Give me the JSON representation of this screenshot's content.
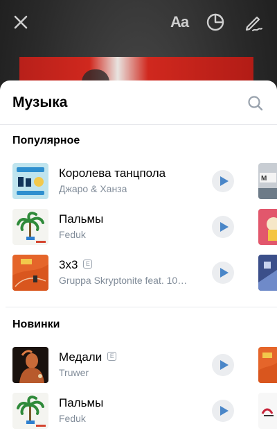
{
  "editor": {
    "text_button_label": "Aa"
  },
  "sheet": {
    "title": "Музыка"
  },
  "sections": [
    {
      "title": "Популярное",
      "tracks": [
        {
          "title": "Королева танцпола",
          "artist": "Джаро & Ханза",
          "explicit": false,
          "cover": "cover-koroleva",
          "peek": "cover-peek-1"
        },
        {
          "title": "Пальмы",
          "artist": "Feduk",
          "explicit": false,
          "cover": "cover-palmy",
          "peek": "cover-peek-2"
        },
        {
          "title": "3x3",
          "artist": "Gruppa Skryptonite feat. 10…",
          "explicit": true,
          "cover": "cover-3x3",
          "peek": "cover-peek-3"
        }
      ]
    },
    {
      "title": "Новинки",
      "tracks": [
        {
          "title": "Медали",
          "artist": "Truwer",
          "explicit": true,
          "cover": "cover-medali",
          "peek": "cover-peek-4"
        },
        {
          "title": "Пальмы",
          "artist": "Feduk",
          "explicit": false,
          "cover": "cover-palmy",
          "peek": "cover-peek-5"
        }
      ]
    }
  ],
  "explicit_badge": "E",
  "colors": {
    "accent": "#4a86c8",
    "subtitle": "#818c99",
    "play_bg": "#ebedf0",
    "divider": "#e7e8ec"
  }
}
